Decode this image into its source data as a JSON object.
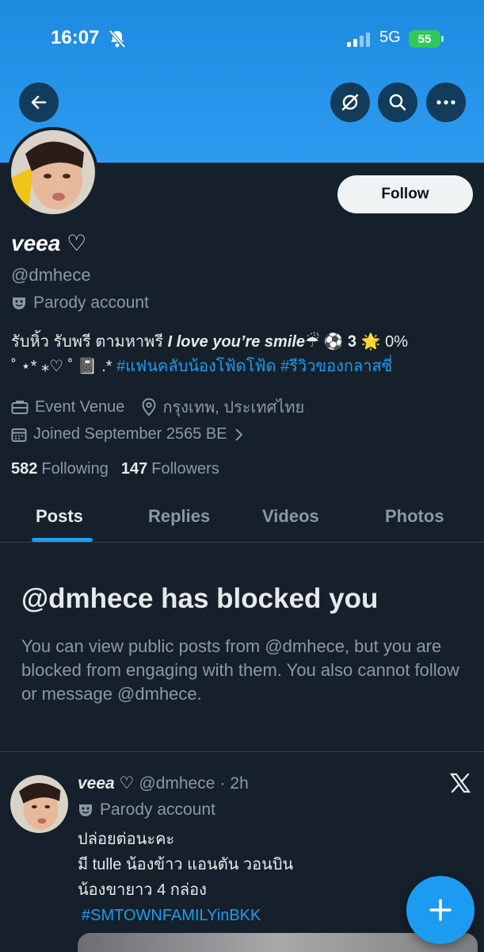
{
  "status_bar": {
    "time": "16:07",
    "network": "5G",
    "battery": "55"
  },
  "colors": {
    "accent": "#1d9bf0",
    "background": "#15202b",
    "banner": "#2d9bf0",
    "muted": "#8b98a5"
  },
  "header": {
    "icons": [
      "back-arrow-icon",
      "grok-icon",
      "search-icon",
      "more-icon"
    ]
  },
  "profile": {
    "display_name": "veea ♡",
    "handle": "@dmhece",
    "parody_label": "Parody account",
    "follow_label": "Follow",
    "bio_line1_prefix": "รับหิ้ว รับพรี ตามหาพรี ",
    "bio_line1_em": "I love you’re smile",
    "bio_line1_suffix": "☔ ⚽ 𝟑 🌟 0%",
    "bio_line2_prefix": "˚ ⋆* ⁎♡ ˚ 📓 .* ",
    "bio_tags": "#แฟนคลับน้องโฟ้ดโฟ้ด #รีวิวของกลาสซี่",
    "category": "Event Venue",
    "location": "กรุงเทพ, ประเทศไทย",
    "joined": "Joined September 2565 BE",
    "following_count": "582",
    "following_label": "Following",
    "followers_count": "147",
    "followers_label": "Followers"
  },
  "tabs": [
    {
      "label": "Posts",
      "active": true
    },
    {
      "label": "Replies",
      "active": false
    },
    {
      "label": "Videos",
      "active": false
    },
    {
      "label": "Photos",
      "active": false
    }
  ],
  "blocked": {
    "title": "@dmhece has blocked you",
    "description": "You can view public posts from @dmhece, but you are blocked from engaging with them. You also cannot follow or message @dmhece."
  },
  "post": {
    "name": "veea ♡",
    "handle": "@dmhece",
    "separator": "·",
    "time": "2h",
    "parody_label": "Parody account",
    "lines": [
      "ปล่อยต่อนะคะ",
      "มี tulle น้องข้าว แอนตัน วอนบิน",
      "น้องขายาว 4 กล่อง"
    ],
    "hashtag": "#SMTOWNFAMILYinBKK"
  }
}
